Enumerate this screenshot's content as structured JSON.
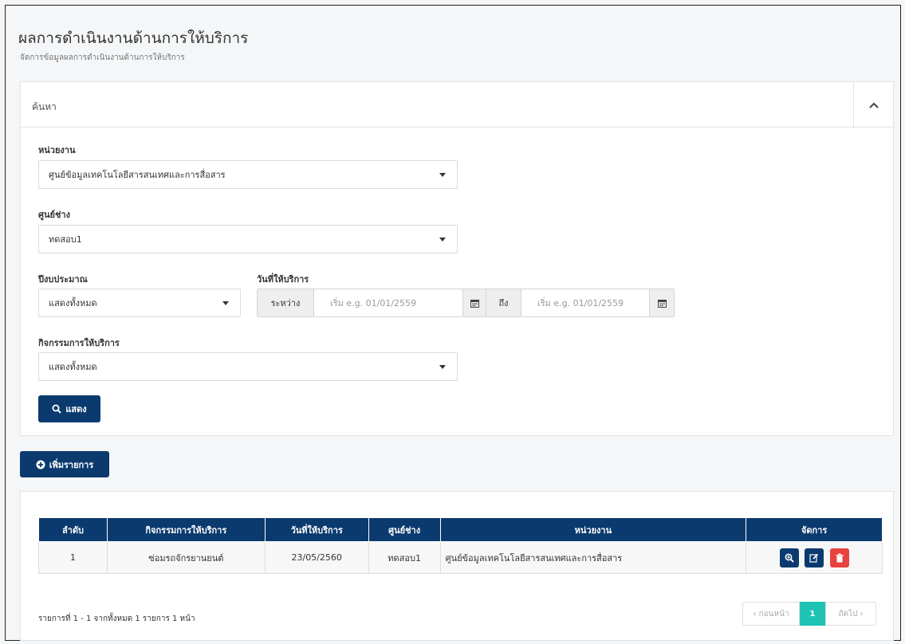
{
  "page": {
    "title": "ผลการดำเนินงานด้านการให้บริการ",
    "subtitle": "จัดการข้อมูลผลการดำเนินงานด้านการให้บริการ"
  },
  "search": {
    "panel_title": "ค้นหา",
    "agency_label": "หน่วยงาน",
    "agency_value": "ศูนย์ข้อมูลเทคโนโลยีสารสนเทศและการสื่อสาร",
    "center_label": "ศูนย์ช่าง",
    "center_value": "ทดสอบ1",
    "fiscal_year_label": "ปีงบประมาณ",
    "fiscal_year_value": "แสดงทั้งหมด",
    "service_date_label": "วันที่ให้บริการ",
    "between_label": "ระหว่าง",
    "start_placeholder": "เริ่ม e.g. 01/01/2559",
    "to_label": "ถึง",
    "end_placeholder": "เริ่ม e.g. 01/01/2559",
    "activity_label": "กิจกรรมการให้บริการ",
    "activity_value": "แสดงทั้งหมด",
    "show_button": "แสดง"
  },
  "add_button": "เพิ่มรายการ",
  "table": {
    "headers": [
      "ลำดับ",
      "กิจกรรมการให้บริการ",
      "วันที่ให้บริการ",
      "ศูนย์ช่าง",
      "หน่วยงาน",
      "จัดการ"
    ],
    "rows": [
      {
        "no": "1",
        "activity": "ซ่อมรถจักรยานยนต์",
        "date": "23/05/2560",
        "center": "ทดสอบ1",
        "agency": "ศูนย์ข้อมูลเทคโนโลยีสารสนเทศและการสื่อสาร"
      }
    ]
  },
  "pagination": {
    "info": "รายการที่ 1 - 1 จากทั้งหมด 1 รายการ 1 หน้า",
    "prev": "‹ ก่อนหน้า",
    "current": "1",
    "next": "ถัดไป ›"
  },
  "colors": {
    "primary": "#0b3a6e",
    "danger": "#e8423f",
    "active_page": "#1ec3b4"
  }
}
